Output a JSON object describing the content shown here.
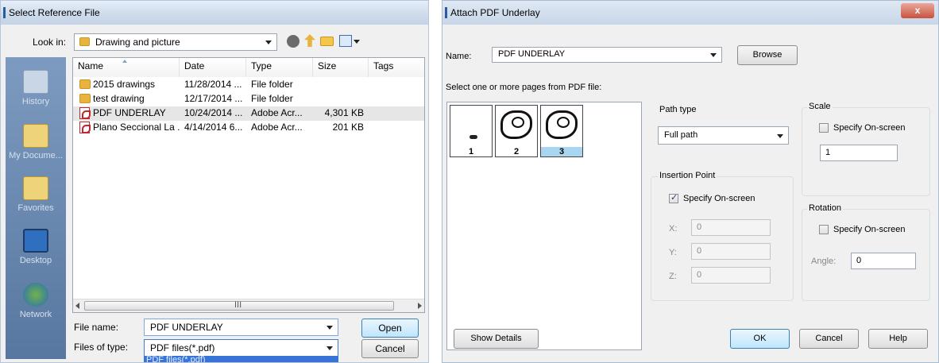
{
  "dialog1": {
    "title": "Select Reference File",
    "look_in_label": "Look in:",
    "look_in_value": "Drawing and picture",
    "places": [
      "History",
      "My Docume...",
      "Favorites",
      "Desktop",
      "Network"
    ],
    "columns": [
      "Name",
      "Date",
      "Type",
      "Size",
      "Tags"
    ],
    "files": [
      {
        "name": "2015 drawings",
        "date": "11/28/2014 ...",
        "type": "File folder",
        "size": "",
        "icon": "folder-icon"
      },
      {
        "name": "test drawing",
        "date": "12/17/2014 ...",
        "type": "File folder",
        "size": "",
        "icon": "folder-icon"
      },
      {
        "name": "PDF UNDERLAY",
        "date": "10/24/2014 ...",
        "type": "Adobe Acr...",
        "size": "4,301 KB",
        "icon": "pdf-icon"
      },
      {
        "name": "Plano Seccional La ...",
        "date": "4/14/2014 6...",
        "type": "Adobe Acr...",
        "size": "201 KB",
        "icon": "pdf-icon"
      }
    ],
    "scroll_mark": "III",
    "file_name_label": "File name:",
    "file_name_value": "PDF UNDERLAY",
    "files_of_type_label": "Files of type:",
    "files_of_type_value": "PDF files(*.pdf)",
    "dropdown_option": "PDF files(*.pdf)",
    "open_label": "Open",
    "cancel_label": "Cancel"
  },
  "dialog2": {
    "title": "Attach PDF Underlay",
    "close_label": "x",
    "name_label": "Name:",
    "name_value": "PDF UNDERLAY",
    "browse_label": "Browse",
    "select_pages_label": "Select one or more pages from PDF file:",
    "pages": [
      "1",
      "2",
      "3"
    ],
    "selected_page": "3",
    "path_type_label": "Path type",
    "path_type_value": "Full path",
    "insertion_point_label": "Insertion Point",
    "insertion_specify_label": "Specify On-screen",
    "insertion_specify_checked": true,
    "x_label": "X:",
    "x_value": "0",
    "y_label": "Y:",
    "y_value": "0",
    "z_label": "Z:",
    "z_value": "0",
    "scale_label": "Scale",
    "scale_specify_label": "Specify On-screen",
    "scale_specify_checked": false,
    "scale_value": "1",
    "rotation_label": "Rotation",
    "rotation_specify_label": "Specify On-screen",
    "rotation_specify_checked": false,
    "angle_label": "Angle:",
    "angle_value": "0",
    "show_details_label": "Show Details",
    "ok_label": "OK",
    "cancel_label": "Cancel",
    "help_label": "Help"
  }
}
